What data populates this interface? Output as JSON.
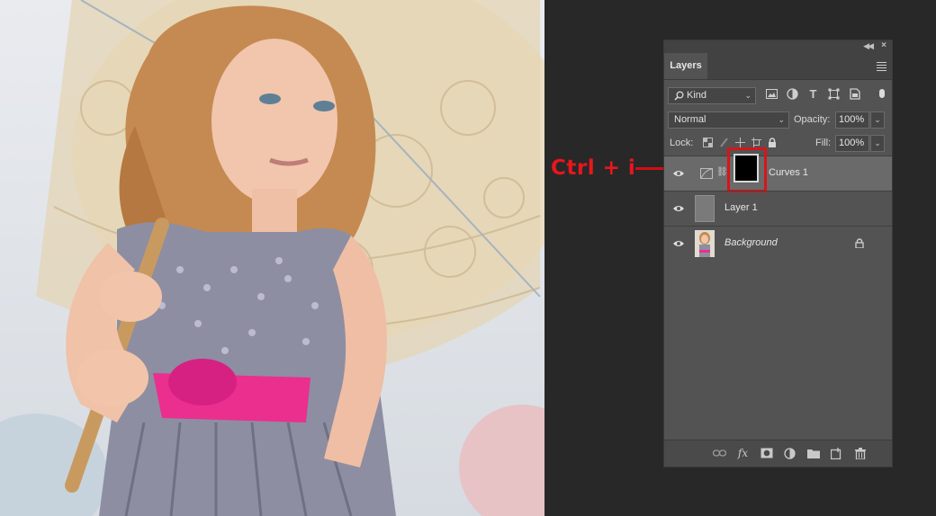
{
  "annotation": {
    "shortcut": "Ctrl + i"
  },
  "panel": {
    "tab_label": "Layers",
    "filter": {
      "kind_label": "Kind",
      "icons": [
        "image-filter-icon",
        "adjustment-filter-icon",
        "type-filter-icon",
        "shape-filter-icon",
        "smart-object-filter-icon"
      ]
    },
    "blend": {
      "mode": "Normal",
      "opacity_label": "Opacity:",
      "opacity_value": "100%"
    },
    "lock": {
      "label": "Lock:",
      "fill_label": "Fill:",
      "fill_value": "100%"
    },
    "layers": [
      {
        "name": "Curves 1",
        "visible": true,
        "selected": true
      },
      {
        "name": "Layer 1",
        "visible": true,
        "selected": false
      },
      {
        "name": "Background",
        "visible": true,
        "selected": false,
        "locked": true
      }
    ],
    "bottom_icons": [
      "link-layers-icon",
      "fx-icon",
      "add-mask-icon",
      "new-adjustment-icon",
      "new-group-icon",
      "new-layer-icon",
      "delete-layer-icon"
    ]
  },
  "colors": {
    "panel_bg": "#535353",
    "selected_row": "#6a6a6a",
    "annotation_red": "#e8161e",
    "app_bg": "#282828"
  }
}
